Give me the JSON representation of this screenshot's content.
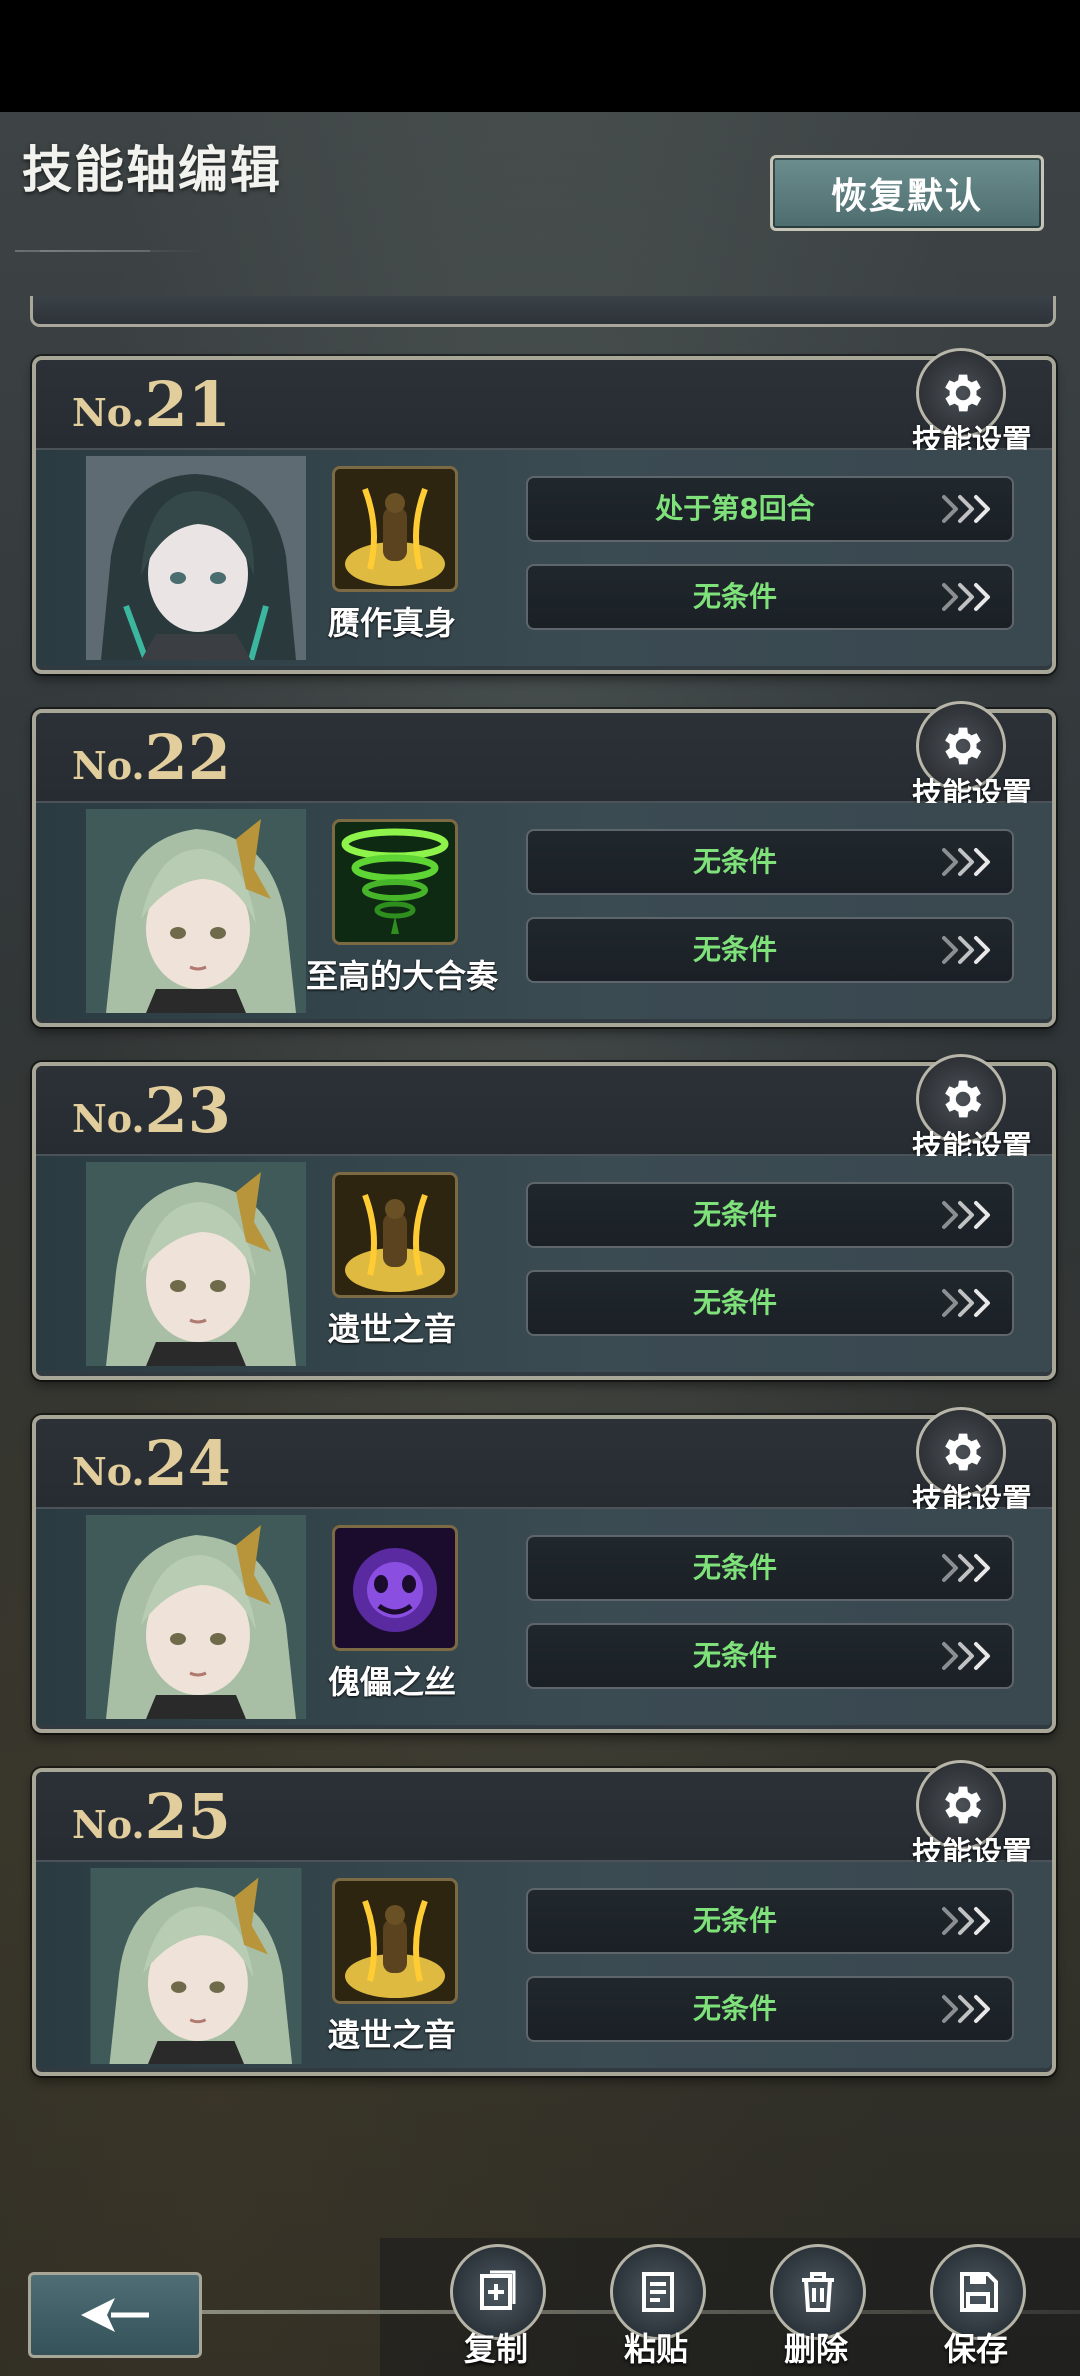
{
  "header": {
    "title": "技能轴编辑",
    "restore_button": "恢复默认"
  },
  "cards": [
    {
      "prefix": "No.",
      "number": "21",
      "settings_label": "技能设置",
      "portrait": "dark-haired-character-portrait",
      "skill_icon": "golden-aura-skill-icon",
      "skill_name": "赝作真身",
      "conditions": [
        "处于第8回合",
        "无条件"
      ]
    },
    {
      "prefix": "No.",
      "number": "22",
      "settings_label": "技能设置",
      "portrait": "green-haired-character-portrait",
      "skill_icon": "green-tornado-skill-icon",
      "skill_name": "至高的大合奏",
      "conditions": [
        "无条件",
        "无条件"
      ]
    },
    {
      "prefix": "No.",
      "number": "23",
      "settings_label": "技能设置",
      "portrait": "green-haired-character-portrait",
      "skill_icon": "golden-aura-skill-icon",
      "skill_name": "遗世之音",
      "conditions": [
        "无条件",
        "无条件"
      ]
    },
    {
      "prefix": "No.",
      "number": "24",
      "settings_label": "技能设置",
      "portrait": "green-haired-character-portrait",
      "skill_icon": "purple-spirit-skill-icon",
      "skill_name": "傀儡之丝",
      "conditions": [
        "无条件",
        "无条件"
      ]
    },
    {
      "prefix": "No.",
      "number": "25",
      "settings_label": "技能设置",
      "portrait": "green-haired-character-portrait",
      "skill_icon": "golden-aura-skill-icon",
      "skill_name": "遗世之音",
      "conditions": [
        "无条件",
        "无条件"
      ]
    }
  ],
  "actions": {
    "copy": "复制",
    "paste": "粘贴",
    "delete": "删除",
    "save": "保存"
  },
  "colors": {
    "condition_text": "#7fe17a",
    "number_gold": "#e2cd9c",
    "card_border": "#a8a697"
  }
}
